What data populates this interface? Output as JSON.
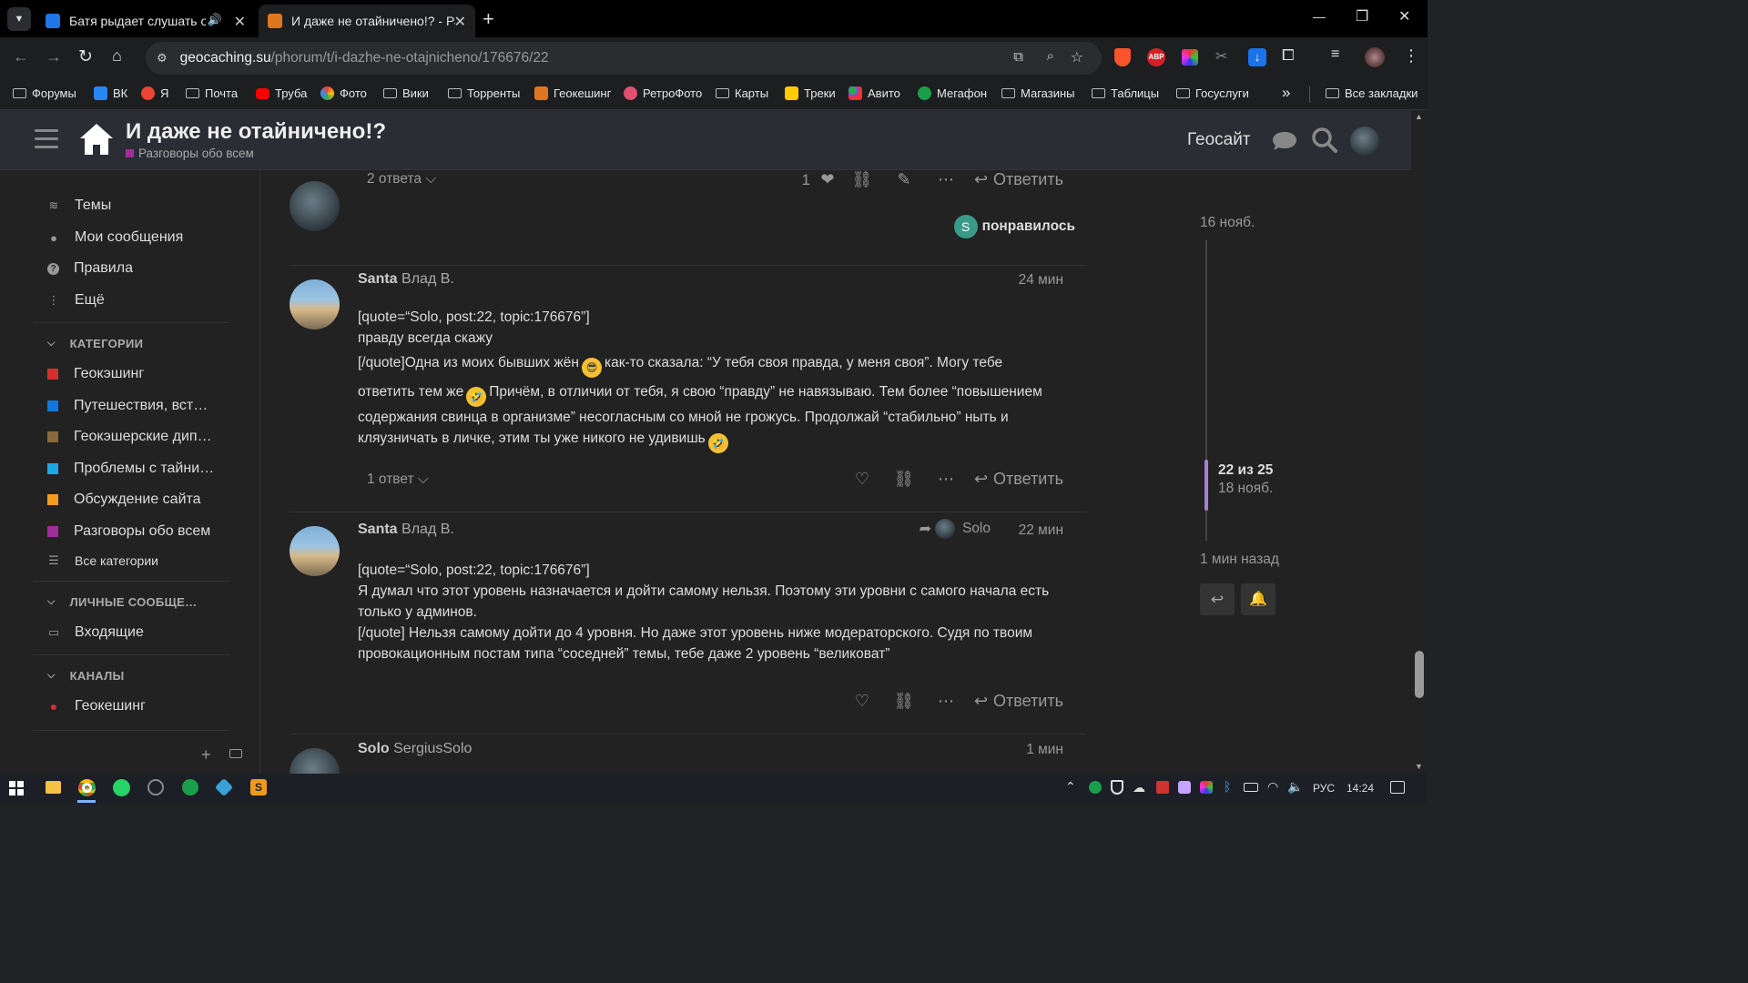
{
  "tabs": [
    {
      "title": "Батя рыдает слушать онла",
      "icon_color": "#1f77e8"
    },
    {
      "title": "И даже не отайничено!? - Раз",
      "icon_color": "#e0771f"
    }
  ],
  "window_controls": {
    "minimize": "—",
    "restore": "❐",
    "close": "✕"
  },
  "toolbar": {
    "url_domain": "geocaching.su",
    "url_path": "/phorum/t/i-dazhe-ne-otajnicheno/176676/22"
  },
  "bookmarks": [
    {
      "label": "Форумы",
      "type": "folder"
    },
    {
      "label": "ВК",
      "type": "icon",
      "color": "#2787f5"
    },
    {
      "label": "Я",
      "type": "icon",
      "color": "#e43"
    },
    {
      "label": "Почта",
      "type": "folder"
    },
    {
      "label": "Труба",
      "type": "icon",
      "color": "#f00"
    },
    {
      "label": "Фото",
      "type": "icon",
      "color": "#4caf50"
    },
    {
      "label": "Вики",
      "type": "folder"
    },
    {
      "label": "Торренты",
      "type": "folder"
    },
    {
      "label": "Геокешинг",
      "type": "icon",
      "color": "#e0771f"
    },
    {
      "label": "РетроФото",
      "type": "icon",
      "color": "#e05070"
    },
    {
      "label": "Карты",
      "type": "folder"
    },
    {
      "label": "Треки",
      "type": "icon",
      "color": "#ffcc00"
    },
    {
      "label": "Авито",
      "type": "icon",
      "color": "#22aa55"
    },
    {
      "label": "Мегафон",
      "type": "icon",
      "color": "#1b9e4b"
    },
    {
      "label": "Магазины",
      "type": "folder"
    },
    {
      "label": "Таблицы",
      "type": "folder"
    },
    {
      "label": "Госуслуги",
      "type": "folder"
    }
  ],
  "bookmarks_more": "»",
  "all_bookmarks": "Все закладки",
  "header": {
    "topic_title": "И даже не отайничено!?",
    "category": "Разговоры обо всем",
    "category_color": "#a12d9c",
    "site_link": "Геосайт"
  },
  "sidebar": {
    "main": [
      {
        "label": "Темы",
        "icon": "layers-icon",
        "glyph": "≋"
      },
      {
        "label": "Мои сообщения",
        "icon": "user-icon",
        "glyph": "●"
      },
      {
        "label": "Правила",
        "icon": "question-icon",
        "glyph": "?"
      },
      {
        "label": "Ещё",
        "icon": "more-vertical-icon",
        "glyph": "⋮"
      }
    ],
    "categories_header": "КАТЕГОРИИ",
    "categories": [
      {
        "label": "Геокэшинг",
        "color": "#d2302f"
      },
      {
        "label": "Путешествия, вст…",
        "color": "#1177dd"
      },
      {
        "label": "Геокэшерские дип…",
        "color": "#8a6a3c"
      },
      {
        "label": "Проблемы с тайни…",
        "color": "#1aa8e6"
      },
      {
        "label": "Обсуждение сайта",
        "color": "#f39c1f"
      },
      {
        "label": "Разговоры обо всем",
        "color": "#a12d9c"
      }
    ],
    "all_categories": "Все категории",
    "messages_header": "ЛИЧНЫЕ СООБЩЕ…",
    "inbox": "Входящие",
    "channels_header": "КАНАЛЫ",
    "channels": [
      {
        "label": "Геокешинг",
        "color": "#d2302f"
      }
    ],
    "add": "+"
  },
  "posts": [
    {
      "replies": "2 ответа",
      "like_count": "1",
      "reply": "Ответить",
      "liked_user_initial": "S",
      "liked_label": "понравилось"
    },
    {
      "username": "Santa",
      "fullname": "Влад В.",
      "time": "24 мин",
      "body": [
        "[quote=“Solo, post:22, topic:176676”]",
        "правду всегда скажу",
        "[/quote]Одна из моих бывших жён",
        "как-то сказала: “У тебя своя правда, у меня своя”. Могу тебе",
        "ответить тем же",
        "Причём, в отличии от тебя, я свою “правду” не навязываю. Тем более “повышением",
        "содержания свинца в организме” несогласным со мной не грожусь. Продолжай “стабильно” ныть и",
        "кляузничать в личке, этим ты уже никого не удивишь"
      ],
      "replies": "1 ответ",
      "reply": "Ответить"
    },
    {
      "username": "Santa",
      "fullname": "Влад В.",
      "reply_to": "Solo",
      "time": "22 мин",
      "body": [
        "[quote=“Solo, post:22, topic:176676”]",
        "Я думал что этот уровень назначается и дойти самому нельзя. Поэтому эти уровни с самого начала есть",
        "только у админов.",
        "[/quote] Нельзя самому дойти до 4 уровня. Но даже этот уровень ниже модераторского. Судя по твоим",
        "провокационным постам типа “соседней” темы, тебе даже 2 уровень “великоват”"
      ],
      "reply": "Ответить"
    },
    {
      "username": "Solo",
      "fullname": "SergiusSolo",
      "time": "1 мин"
    }
  ],
  "timeline": {
    "start_date": "16 нояб.",
    "position": "22 из 25",
    "current_date": "18 нояб.",
    "last_activity": "1 мин назад",
    "progress": 0.88
  },
  "taskbar": {
    "language": "РУС",
    "clock": "14:24"
  }
}
